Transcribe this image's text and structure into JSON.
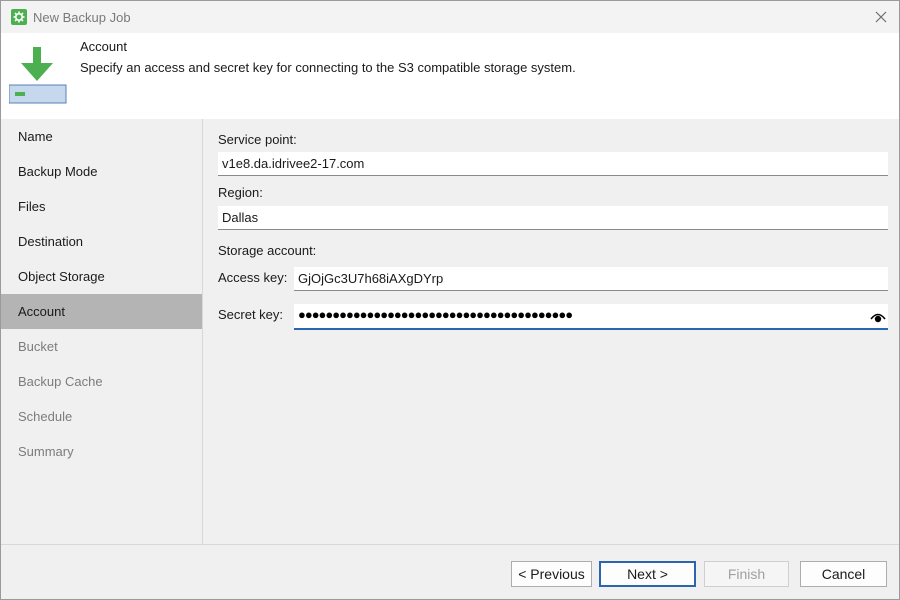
{
  "window": {
    "title": "New Backup Job",
    "icon": "gear-icon",
    "close_icon": "close-icon"
  },
  "header": {
    "title": "Account",
    "description": "Specify an access and secret key for connecting to the S3 compatible storage system.",
    "icon": "download-to-storage-icon",
    "accent_color": "#4caf50"
  },
  "sidebar": {
    "items": [
      {
        "label": "Name",
        "state": "normal"
      },
      {
        "label": "Backup Mode",
        "state": "normal"
      },
      {
        "label": "Files",
        "state": "normal"
      },
      {
        "label": "Destination",
        "state": "normal"
      },
      {
        "label": "Object Storage",
        "state": "normal"
      },
      {
        "label": "Account",
        "state": "active"
      },
      {
        "label": "Bucket",
        "state": "disabled"
      },
      {
        "label": "Backup Cache",
        "state": "disabled"
      },
      {
        "label": "Schedule",
        "state": "disabled"
      },
      {
        "label": "Summary",
        "state": "disabled"
      }
    ]
  },
  "form": {
    "service_point_label": "Service point:",
    "service_point_value": "v1e8.da.idrivee2-17.com",
    "region_label": "Region:",
    "region_value": "Dallas",
    "storage_account_label": "Storage account:",
    "access_key_label": "Access key:",
    "access_key_value": "GjOjGc3U7h68iAXgDYrp",
    "secret_key_label": "Secret key:",
    "secret_key_masked": "●●●●●●●●●●●●●●●●●●●●●●●●●●●●●●●●●●●●●●●●",
    "secret_key_icon": "eye-icon",
    "focus_color": "#2b65b0"
  },
  "footer": {
    "previous_label": "< Previous",
    "next_label": "Next >",
    "finish_label": "Finish",
    "cancel_label": "Cancel"
  }
}
